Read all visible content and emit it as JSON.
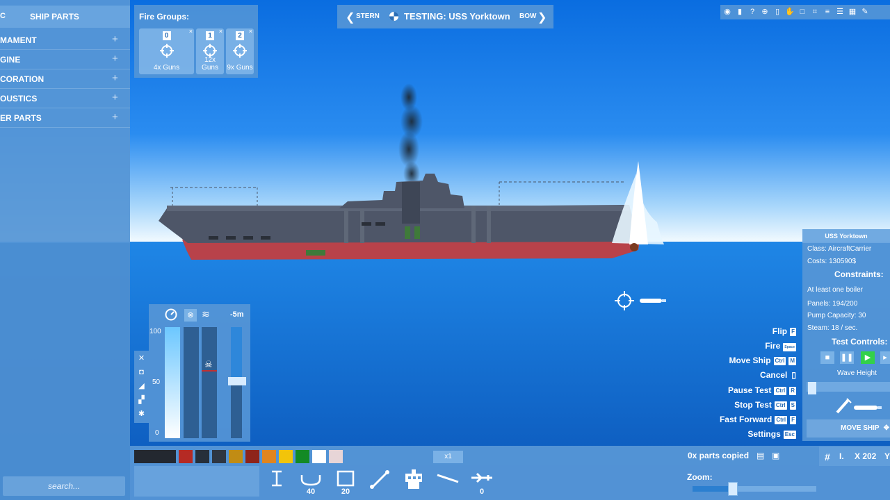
{
  "sidebar": {
    "title": "SHIP PARTS",
    "header_icon": "C",
    "categories": [
      {
        "label": "MAMENT",
        "icon": "plus-icon"
      },
      {
        "label": "GINE",
        "icon": "plus-icon"
      },
      {
        "label": "CORATION",
        "icon": "plus-icon"
      },
      {
        "label": "OUSTICS",
        "icon": "plus-icon"
      },
      {
        "label": "ER PARTS",
        "icon": "plus-icon"
      }
    ],
    "search_placeholder": "search..."
  },
  "fire_groups": {
    "title": "Fire Groups:",
    "groups": [
      {
        "index": "0",
        "caption": "4x Guns"
      },
      {
        "index": "1",
        "caption": "12x Guns"
      },
      {
        "index": "2",
        "caption": "9x Guns"
      }
    ],
    "remove_glyph": "×"
  },
  "topbar": {
    "stern_label": "STERN",
    "title": "TESTING: USS Yorktown",
    "bow_label": "BOW",
    "left_arrow": "❮",
    "right_arrow": "❯"
  },
  "toolbar_icons": [
    "eye-icon",
    "book-icon",
    "help-icon",
    "target-icon",
    "battery-icon",
    "hand-icon",
    "square-icon",
    "crop-icon",
    "menu-icon",
    "align-icon",
    "chart-icon",
    "wrench-icon"
  ],
  "speed_panel": {
    "depth_label": "-5m",
    "scale_top": "100",
    "scale_mid": "50",
    "scale_bottom": "0",
    "throttle_level": 1.0,
    "depth_level": 0.54
  },
  "right_panel": {
    "ship_name": "USS Yorktown",
    "class_line": "Class: AircraftCarrier",
    "costs_line": "Costs: 130590$",
    "constraints_title": "Constraints:",
    "constraint_boiler": "At least one boiler",
    "panels_line": "Panels: 194/200",
    "pump_line": "Pump Capacity: 30",
    "steam_line": "Steam: 18 / sec.",
    "test_controls_title": "Test Controls:",
    "wave_height_label": "Wave Height",
    "move_ship_label": "MOVE SHIP"
  },
  "key_hints": [
    {
      "label": "Flip",
      "keys": [
        "F"
      ]
    },
    {
      "label": "Fire",
      "keys": [
        "Space"
      ]
    },
    {
      "label": "Move Ship",
      "keys": [
        "Ctrl",
        "M"
      ]
    },
    {
      "label": "Cancel",
      "keys": []
    },
    {
      "label": "Pause Test",
      "keys": [
        "Ctrl",
        "R"
      ]
    },
    {
      "label": "Stop Test",
      "keys": [
        "Ctrl",
        "S"
      ]
    },
    {
      "label": "Fast Forward",
      "keys": [
        "Ctrl",
        "F"
      ]
    },
    {
      "label": "Settings",
      "keys": [
        "Esc"
      ]
    }
  ],
  "palette": [
    "#232830",
    "#b52a24",
    "#262f3a",
    "#2e3642",
    "#c18c14",
    "#8e241b",
    "#e0851f",
    "#f2c40a",
    "#138a25",
    "#ffffff",
    "#e7d5d7"
  ],
  "multiplier": "x1",
  "tools": [
    {
      "icon": "ibeam-icon",
      "count": ""
    },
    {
      "icon": "hull-icon",
      "count": "40"
    },
    {
      "icon": "frame-icon",
      "count": "20"
    },
    {
      "icon": "strut-icon",
      "count": ""
    },
    {
      "icon": "bridge-icon",
      "count": ""
    },
    {
      "icon": "line-icon",
      "count": ""
    },
    {
      "icon": "plane-icon",
      "count": "0"
    }
  ],
  "parts_copied": "0x parts copied",
  "zoom_label": "Zoom:",
  "zoom_level": 0.3,
  "coords": {
    "x_label": "X 202",
    "y_label": "Y",
    "grid_icon": "#",
    "sep": "I."
  }
}
